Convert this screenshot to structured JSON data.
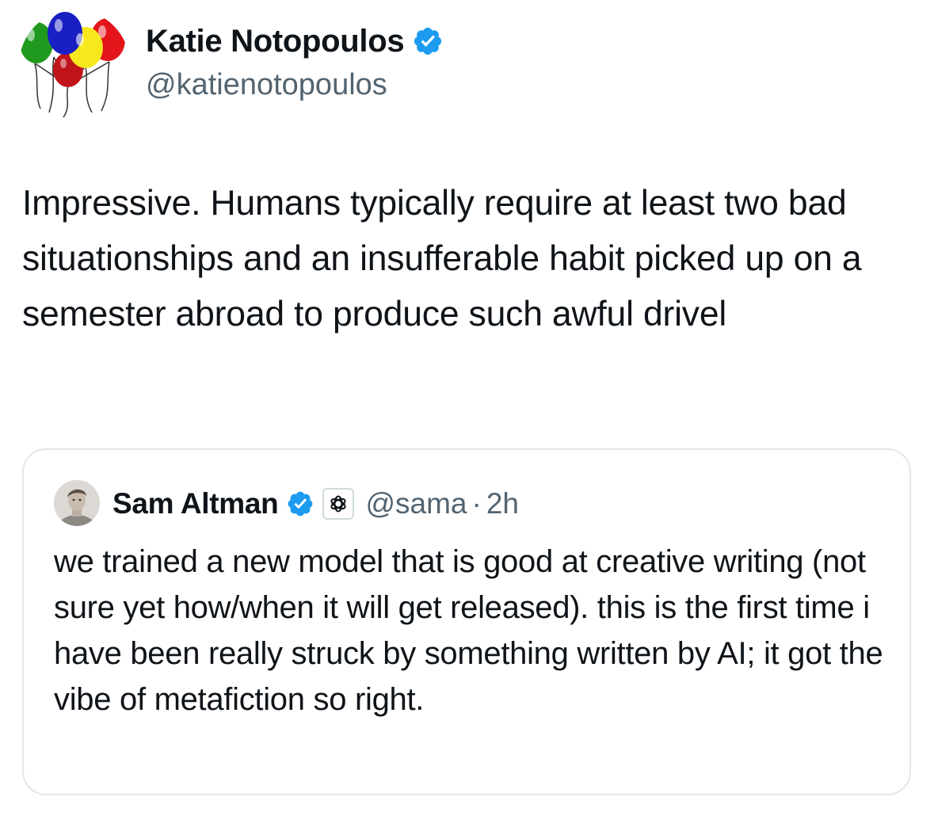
{
  "tweet": {
    "author": {
      "name": "Katie Notopoulos",
      "handle": "@katienotopoulos",
      "verified": true,
      "avatar_icon": "balloons-avatar-icon"
    },
    "text": "Impressive. Humans typically require at least two bad situationships and an insufferable habit picked up on a semester abroad to produce such awful drivel"
  },
  "quoted_tweet": {
    "author": {
      "name": "Sam Altman",
      "handle": "@sama",
      "verified": true,
      "affiliate_icon": "openai-logo-icon"
    },
    "separator": "·",
    "time": "2h",
    "text": "we trained a new model that is good at creative writing (not sure yet how/when it will get released). this is the first time i have been really struck by something written by AI; it got the vibe of metafiction so right."
  },
  "colors": {
    "verified_blue": "#1d9bf0",
    "secondary_text": "#536471",
    "primary_text": "#0f1419",
    "quote_border": "#e3e7ea"
  }
}
